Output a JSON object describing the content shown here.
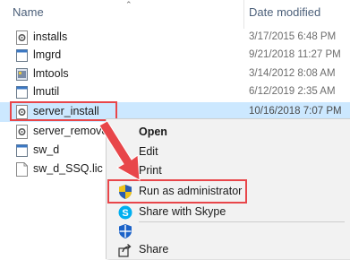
{
  "header": {
    "name_label": "Name",
    "date_label": "Date modified"
  },
  "files": [
    {
      "name": "installs",
      "date": "3/17/2015 6:48 PM",
      "icon": "settings-file-icon"
    },
    {
      "name": "lmgrd",
      "date": "9/21/2018 11:27 PM",
      "icon": "exe-file-icon"
    },
    {
      "name": "lmtools",
      "date": "3/14/2012 8:08 AM",
      "icon": "app-file-icon"
    },
    {
      "name": "lmutil",
      "date": "6/12/2019 2:35 AM",
      "icon": "exe-file-icon"
    },
    {
      "name": "server_install",
      "date": "10/16/2018 7:07 PM",
      "icon": "settings-file-icon"
    },
    {
      "name": "server_remove",
      "date": "",
      "icon": "settings-file-icon"
    },
    {
      "name": "sw_d",
      "date": "",
      "icon": "exe-file-icon"
    },
    {
      "name": "sw_d_SSQ.lic",
      "date": "",
      "icon": "document-file-icon"
    }
  ],
  "context_menu": {
    "items": [
      {
        "label": "Open",
        "icon": ""
      },
      {
        "label": "Edit",
        "icon": ""
      },
      {
        "label": "Print",
        "icon": ""
      },
      {
        "label": "Run as administrator",
        "icon": "uac-shield-icon"
      },
      {
        "label": "Share with Skype",
        "icon": "skype-icon"
      },
      {
        "label": "",
        "icon": "windows-defender-icon"
      },
      {
        "label": "Share",
        "icon": "share-icon"
      }
    ]
  },
  "colors": {
    "highlight": "#e8464a",
    "selection": "#cce8ff"
  }
}
